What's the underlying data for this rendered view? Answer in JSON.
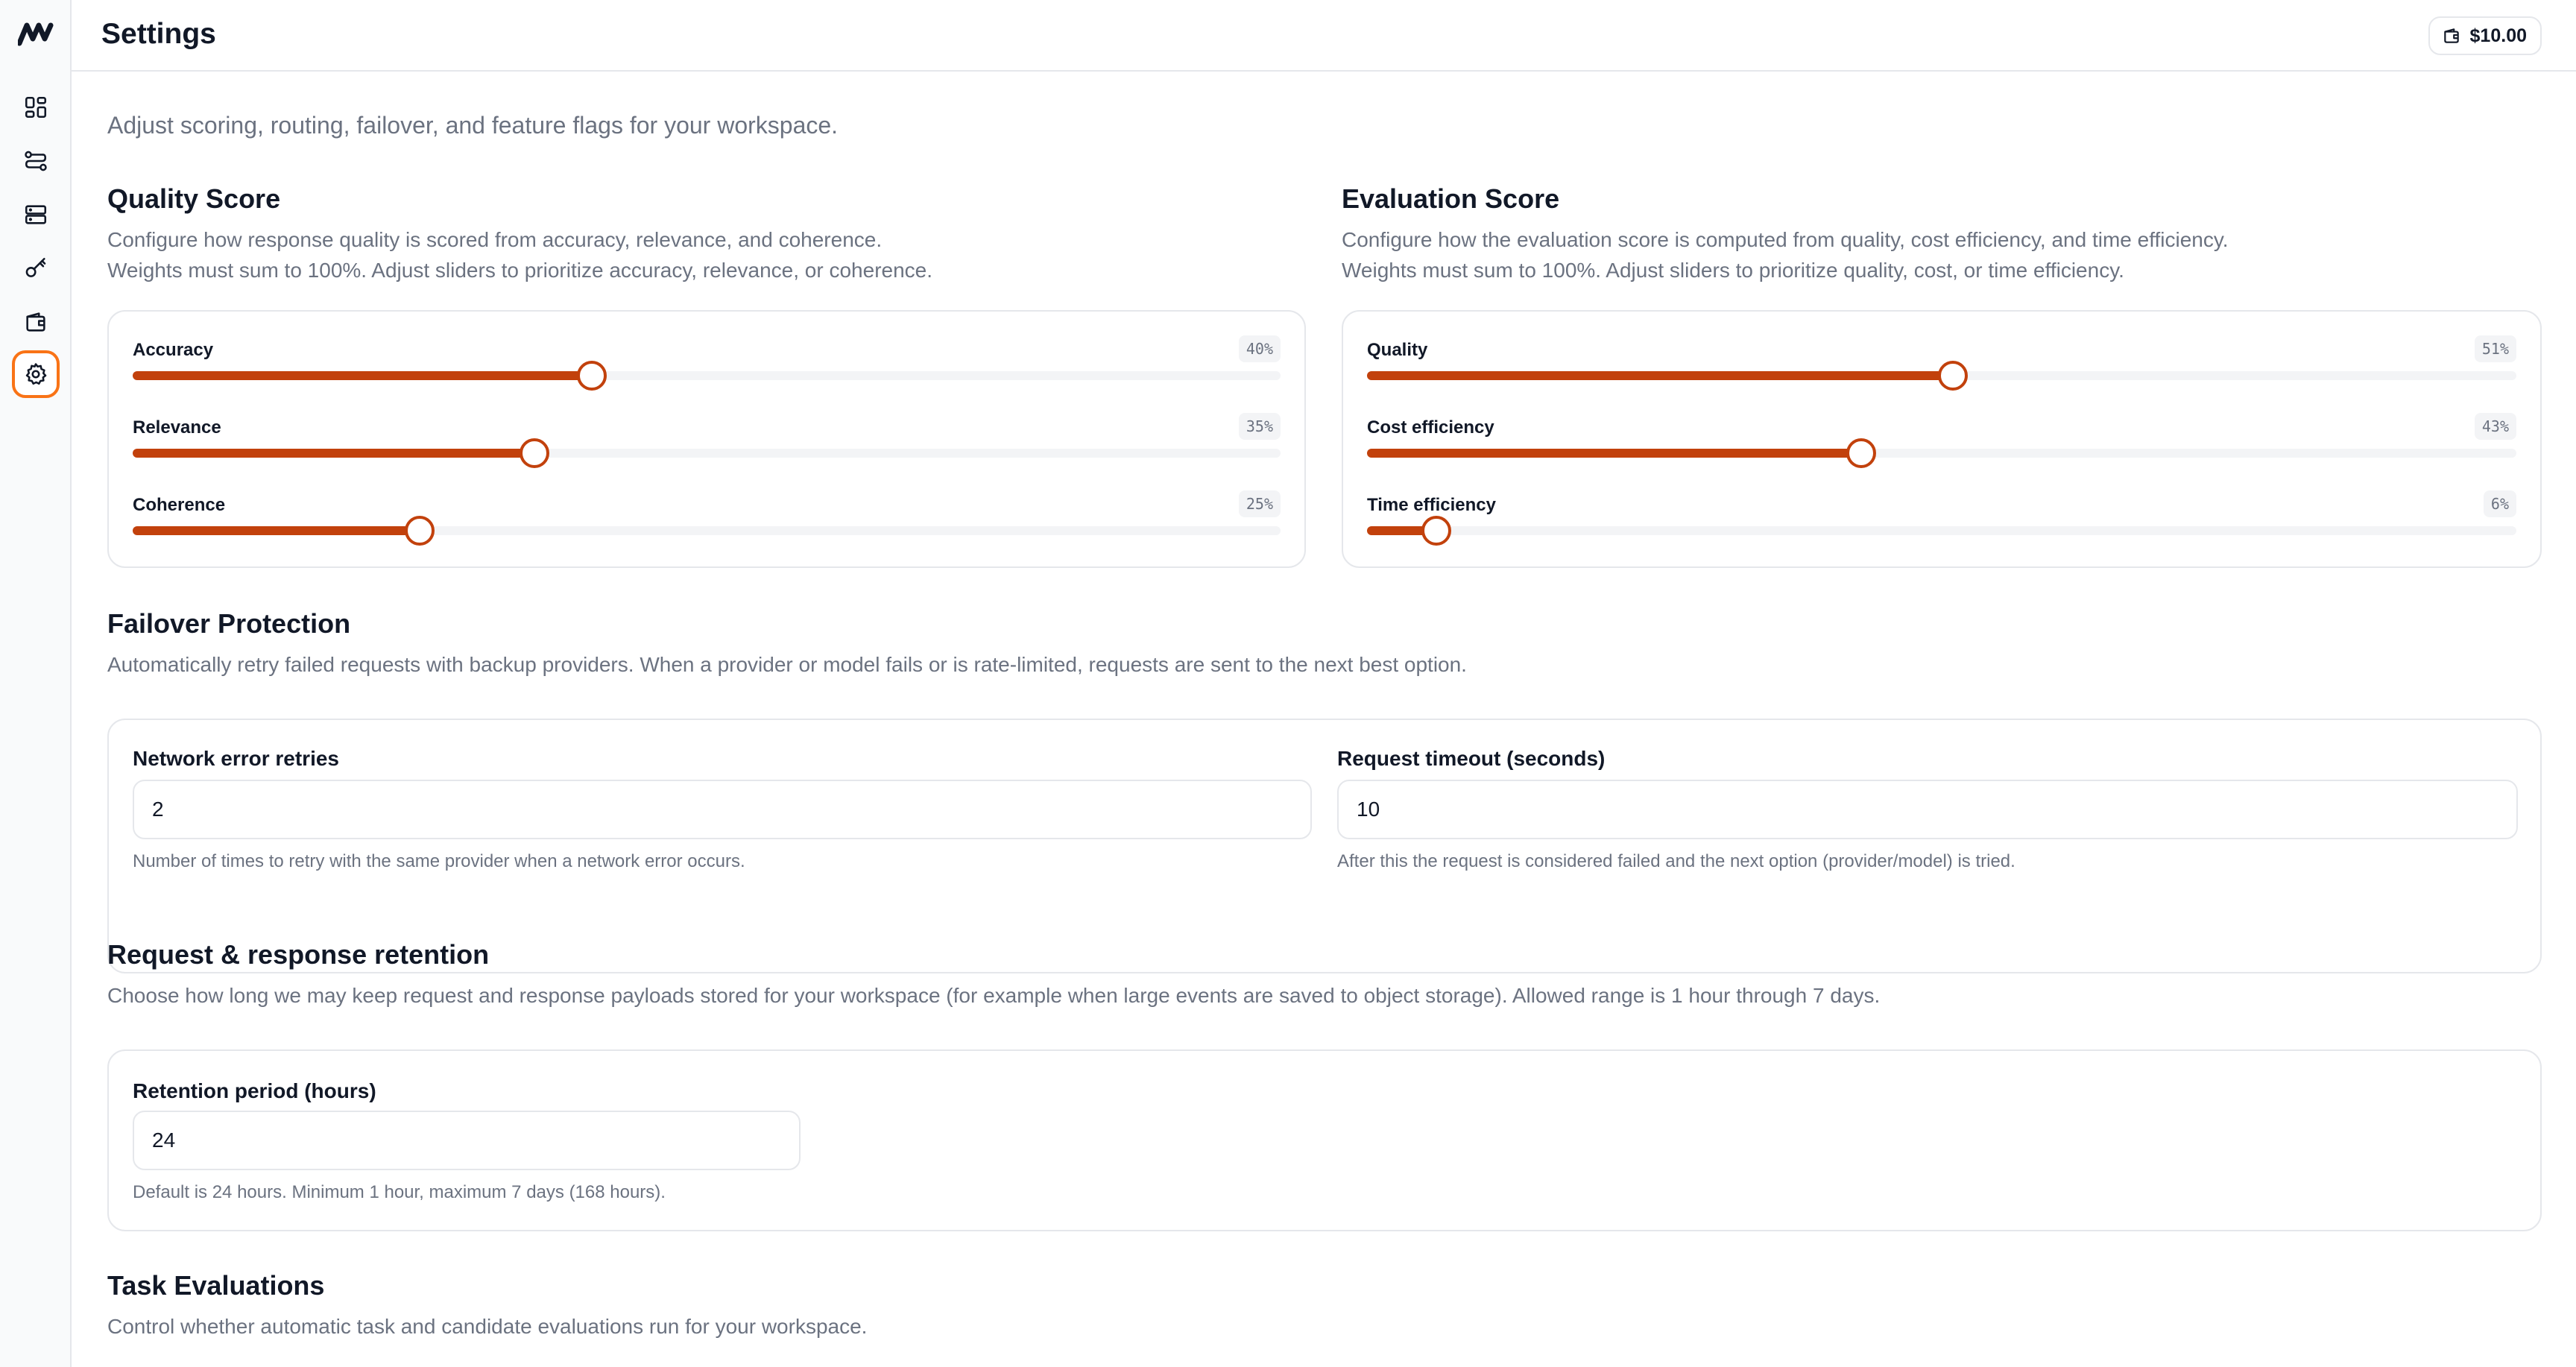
{
  "sidebar": {
    "logo_icon": "logo-icon",
    "items": [
      {
        "name": "dashboard",
        "icon": "dashboard-icon"
      },
      {
        "name": "routing",
        "icon": "routing-icon"
      },
      {
        "name": "storage",
        "icon": "server-icon"
      },
      {
        "name": "keys",
        "icon": "key-icon"
      },
      {
        "name": "billing",
        "icon": "wallet-icon"
      },
      {
        "name": "settings",
        "icon": "gear-icon",
        "active": true
      }
    ]
  },
  "header": {
    "title": "Settings",
    "balance": "$10.00",
    "balance_icon": "wallet-icon"
  },
  "intro": "Adjust scoring, routing, failover, and feature flags for your workspace.",
  "quality": {
    "title": "Quality Score",
    "desc1": "Configure how response quality is scored from accuracy, relevance, and coherence.",
    "desc2": "Weights must sum to 100%. Adjust sliders to prioritize accuracy, relevance, or coherence.",
    "sliders": [
      {
        "label": "Accuracy",
        "display": "40%",
        "value": 40
      },
      {
        "label": "Relevance",
        "display": "35%",
        "value": 35
      },
      {
        "label": "Coherence",
        "display": "25%",
        "value": 25
      }
    ]
  },
  "evaluation": {
    "title": "Evaluation Score",
    "desc1": "Configure how the evaluation score is computed from quality, cost efficiency, and time efficiency.",
    "desc2": "Weights must sum to 100%. Adjust sliders to prioritize quality, cost, or time efficiency.",
    "sliders": [
      {
        "label": "Quality",
        "display": "51%",
        "value": 51
      },
      {
        "label": "Cost efficiency",
        "display": "43%",
        "value": 43
      },
      {
        "label": "Time efficiency",
        "display": "6%",
        "value": 6
      }
    ]
  },
  "failover": {
    "title": "Failover Protection",
    "desc": "Automatically retry failed requests with backup providers. When a provider or model fails or is rate-limited, requests are sent to the next best option.",
    "retries_label": "Network error retries",
    "retries_value": "2",
    "retries_help": "Number of times to retry with the same provider when a network error occurs.",
    "timeout_label": "Request timeout (seconds)",
    "timeout_value": "10",
    "timeout_help": "After this the request is considered failed and the next option (provider/model) is tried."
  },
  "retention": {
    "title": "Request & response retention",
    "desc": "Choose how long we may keep request and response payloads stored for your workspace (for example when large events are saved to object storage). Allowed range is 1 hour through 7 days.",
    "label": "Retention period (hours)",
    "value": "24",
    "help": "Default is 24 hours. Minimum 1 hour, maximum 7 days (168 hours)."
  },
  "task_eval": {
    "title": "Task Evaluations",
    "desc": "Control whether automatic task and candidate evaluations run for your workspace."
  },
  "colors": {
    "accent": "#c2410c",
    "active_ring": "#f97316",
    "muted_text": "#6b7280",
    "border": "#e5e7eb"
  }
}
